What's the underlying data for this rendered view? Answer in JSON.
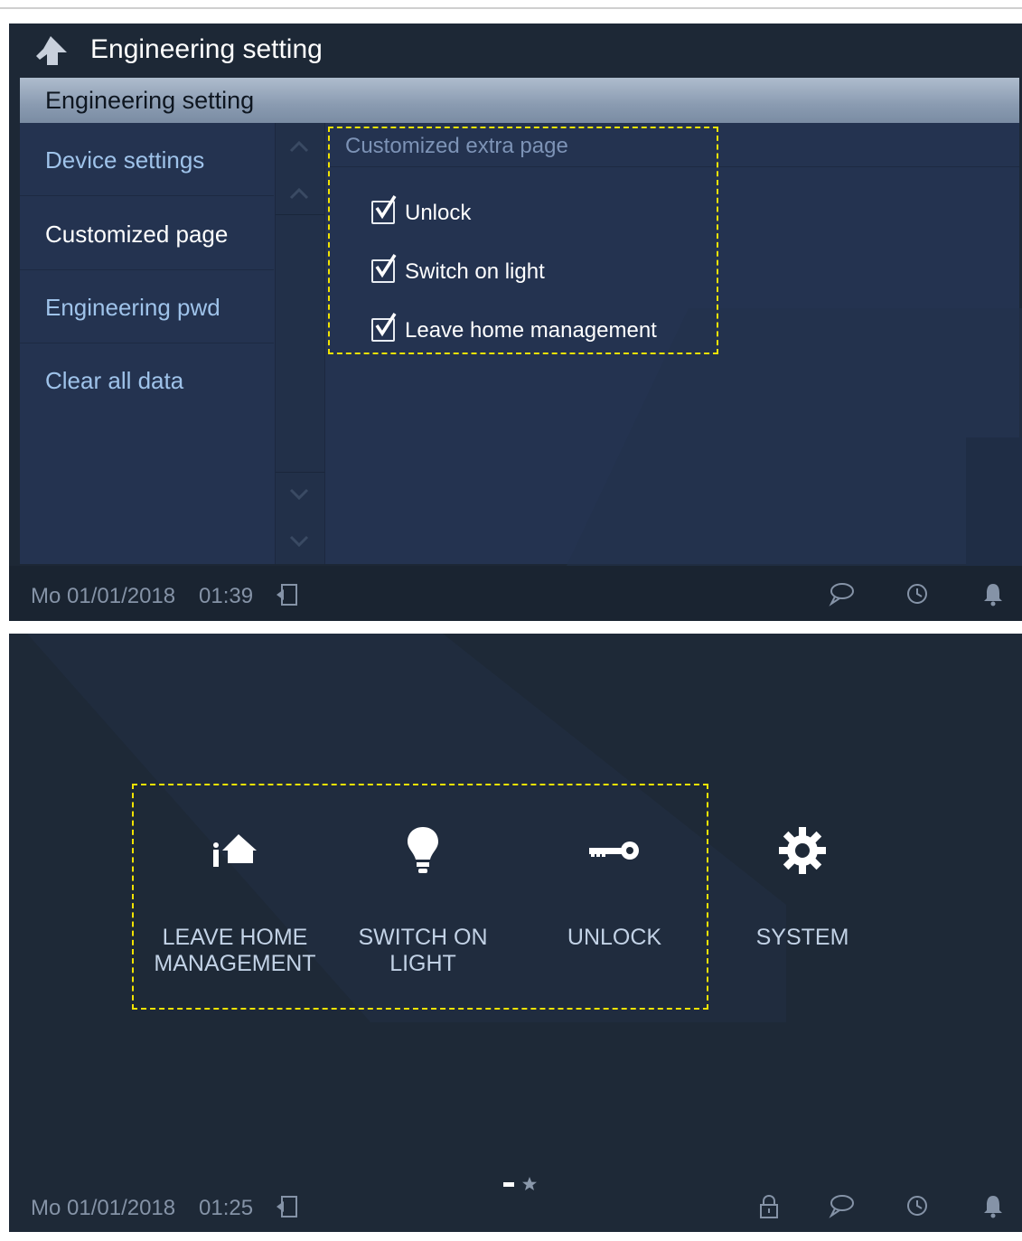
{
  "screen1": {
    "title": "Engineering setting",
    "section_header": "Engineering setting",
    "sidebar": [
      {
        "label": "Device settings",
        "selected": false
      },
      {
        "label": "Customized page",
        "selected": true
      },
      {
        "label": "Engineering pwd",
        "selected": false
      },
      {
        "label": "Clear all data",
        "selected": false
      }
    ],
    "content_header": "Customized extra page",
    "checkboxes": [
      {
        "label": "Unlock",
        "checked": true
      },
      {
        "label": "Switch on light",
        "checked": true
      },
      {
        "label": "Leave home management",
        "checked": true
      }
    ],
    "status": {
      "date": "Mo 01/01/2018",
      "time": "01:39"
    }
  },
  "screen2": {
    "tiles": [
      {
        "line1": "LEAVE HOME",
        "line2": "MANAGEMENT",
        "icon": "leave-home-icon"
      },
      {
        "line1": "SWITCH ON",
        "line2": "LIGHT",
        "icon": "light-bulb-icon"
      },
      {
        "line1": "UNLOCK",
        "line2": "",
        "icon": "key-icon"
      },
      {
        "line1": "SYSTEM",
        "line2": "",
        "icon": "gear-icon"
      }
    ],
    "status": {
      "date": "Mo 01/01/2018",
      "time": "01:25"
    }
  },
  "colors": {
    "highlight_dash": "#f2e300",
    "panel": "#243350",
    "background": "#1d2836"
  }
}
